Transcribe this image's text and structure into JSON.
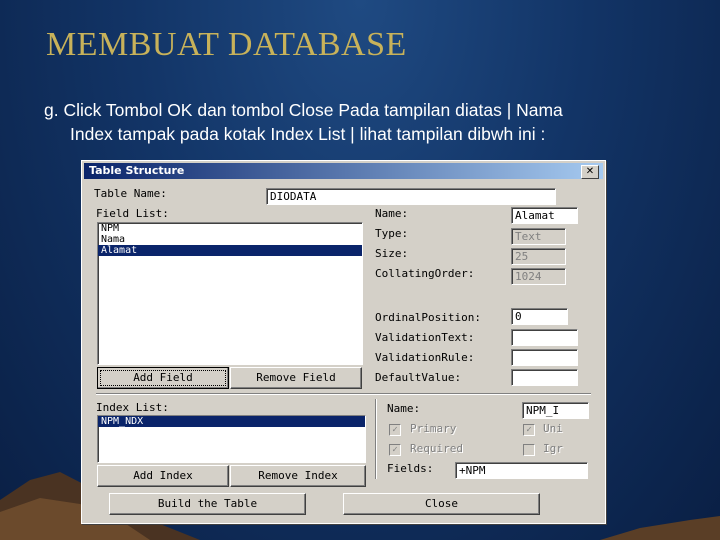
{
  "slide": {
    "title": "MEMBUAT  DATABASE",
    "text_line1": "g. Click Tombol OK  dan tombol Close  Pada tampilan diatas | Nama",
    "text_line2": "Index tampak pada kotak Index List  |  lihat tampilan dibwh ini :"
  },
  "dialog": {
    "title": "Table Structure",
    "close_glyph": "✕",
    "table_name_label": "Table Name:",
    "table_name_value": "DIODATA",
    "field_list_label": "Field List:",
    "fields": [
      "NPM",
      "Nama",
      "Alamat"
    ],
    "selected_field": "Alamat",
    "props": {
      "name_label": "Name:",
      "name_value": "Alamat",
      "type_label": "Type:",
      "type_value": "Text",
      "size_label": "Size:",
      "size_value": "25",
      "collating_label": "CollatingOrder:",
      "collating_value": "1024",
      "ordinal_label": "OrdinalPosition:",
      "ordinal_value": "0",
      "validation_text_label": "ValidationText:",
      "validation_text_value": "",
      "validation_rule_label": "ValidationRule:",
      "validation_rule_value": "",
      "default_value_label": "DefaultValue:",
      "default_value_value": ""
    },
    "add_field_label": "Add Field",
    "remove_field_label": "Remove Field",
    "index_list_label": "Index List:",
    "indexes": [
      "NPM_NDX"
    ],
    "index": {
      "name_label": "Name:",
      "name_value": "NPM_I",
      "primary_label": "Primary",
      "unique_label": "Uni",
      "required_label": "Required",
      "ignore_label": "Igr",
      "fields_label": "Fields:",
      "fields_value": "+NPM"
    },
    "add_index_label": "Add Index",
    "remove_index_label": "Remove Index",
    "build_label": "Build the Table",
    "close_label": "Close"
  },
  "colors": {
    "title_gold": "#c8b25a",
    "background_navy": "#123466",
    "selection": "#0a246a"
  }
}
